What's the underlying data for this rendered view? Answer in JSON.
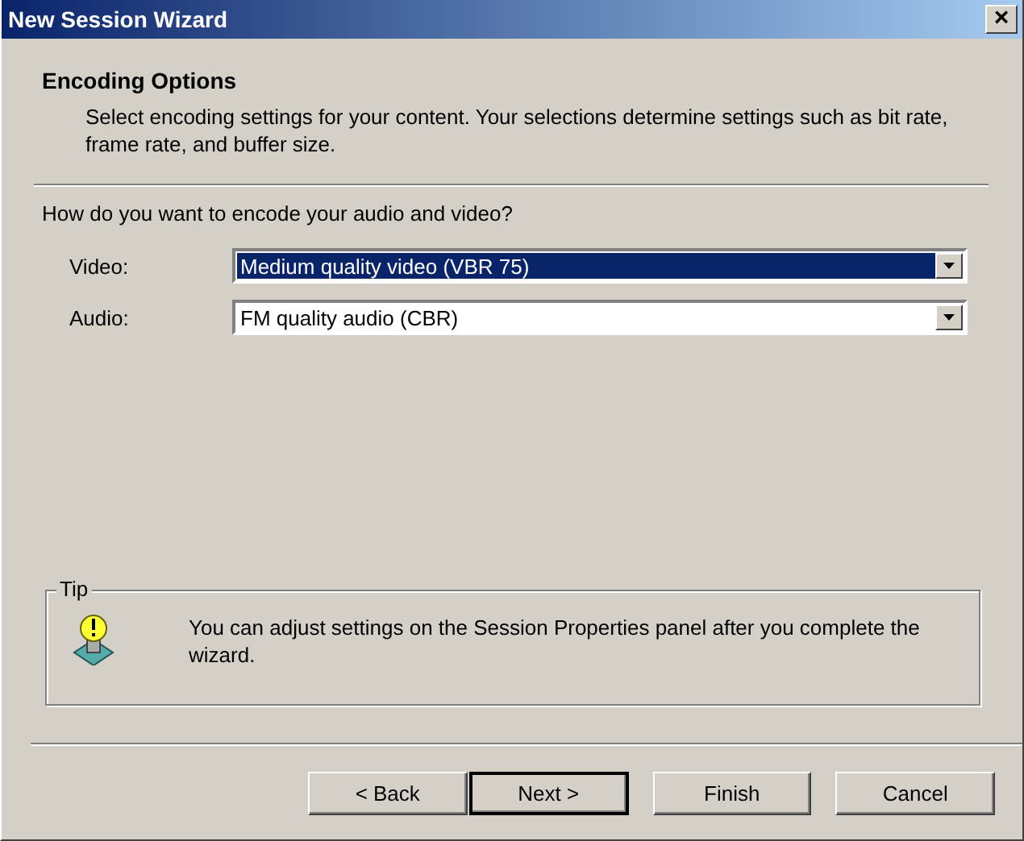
{
  "window": {
    "title": "New Session Wizard",
    "close": "×"
  },
  "header": {
    "title": "Encoding Options",
    "description": "Select encoding settings for your content. Your selections determine settings such as bit rate, frame rate, and buffer size."
  },
  "question": "How do you want to encode your audio and video?",
  "fields": [
    {
      "label": "Video:",
      "value": "Medium quality video (VBR 75)",
      "selected": true
    },
    {
      "label": "Audio:",
      "value": "FM quality audio (CBR)",
      "selected": false
    }
  ],
  "tip": {
    "title": "Tip",
    "text": "You can adjust settings on the Session Properties panel after you complete the wizard."
  },
  "buttons": [
    {
      "label": "< Back",
      "default": false
    },
    {
      "label": "Next >",
      "default": true
    },
    {
      "label": "Finish",
      "default": false
    },
    {
      "label": "Cancel",
      "default": false
    }
  ]
}
